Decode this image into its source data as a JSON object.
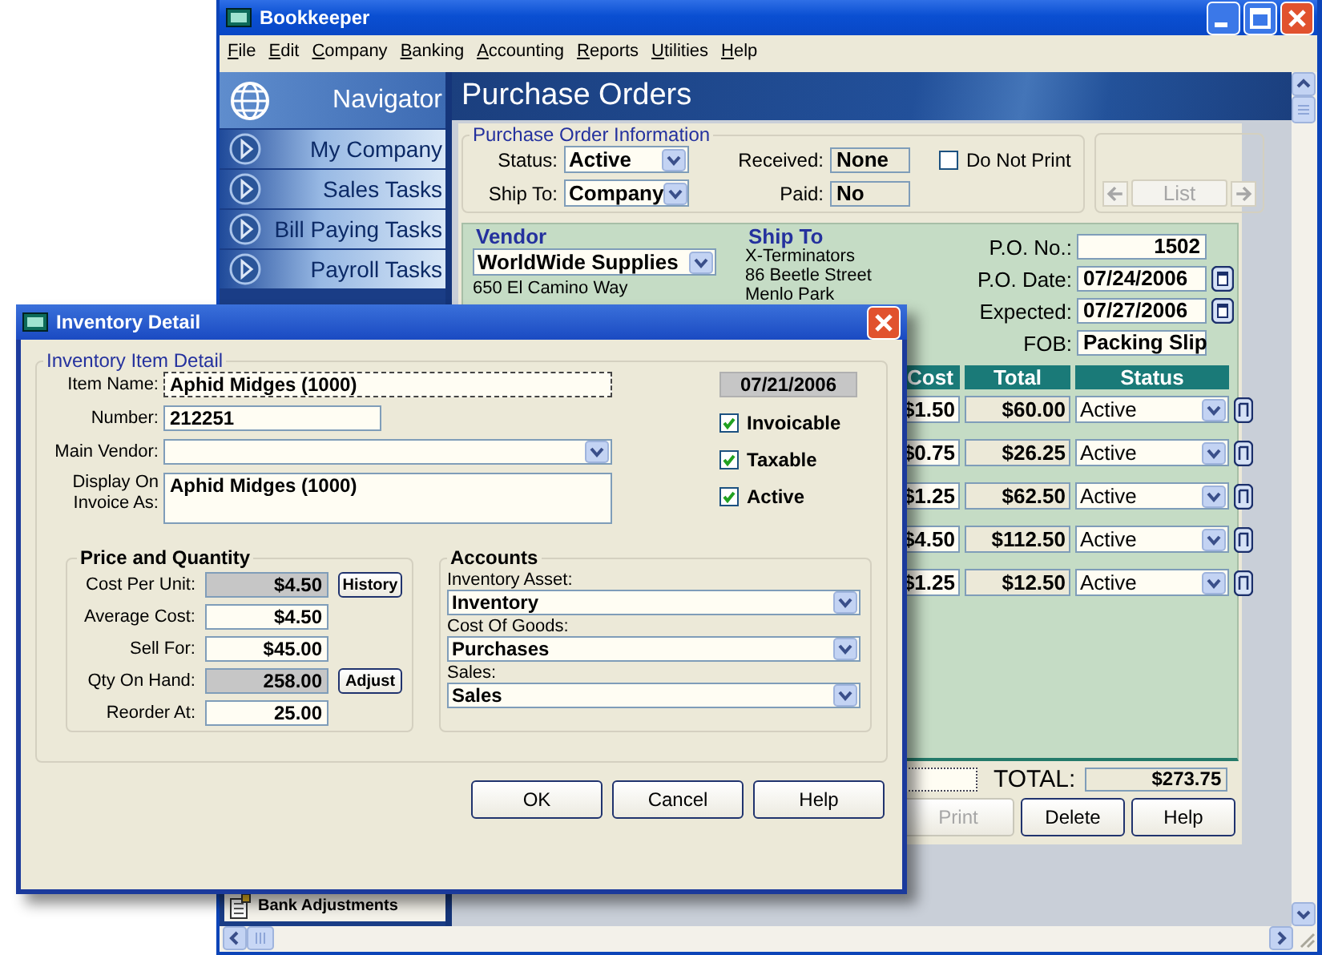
{
  "main_window": {
    "title": "Bookkeeper",
    "menu": [
      "File",
      "Edit",
      "Company",
      "Banking",
      "Accounting",
      "Reports",
      "Utilities",
      "Help"
    ]
  },
  "navigator": {
    "title": "Navigator",
    "items": [
      {
        "label": "My Company"
      },
      {
        "label": "Sales Tasks"
      },
      {
        "label": "Bill Paying Tasks"
      },
      {
        "label": "Payroll Tasks"
      }
    ],
    "bottom_item": "Bank Adjustments"
  },
  "purchase_orders": {
    "title": "Purchase Orders",
    "info": {
      "title": "Purchase Order Information",
      "status_label": "Status:",
      "status": "Active",
      "ship_to_label": "Ship To:",
      "ship_to": "Company",
      "received_label": "Received:",
      "received": "None",
      "paid_label": "Paid:",
      "paid": "No",
      "do_not_print": {
        "label": "Do Not Print",
        "checked": false
      },
      "list_button": {
        "label": "List",
        "disabled": true
      }
    },
    "vendor": {
      "heading": "Vendor",
      "name": "WorldWide Supplies",
      "address": [
        "650 El Camino Way"
      ]
    },
    "ship_to": {
      "heading": "Ship To",
      "lines": [
        "X-Terminators",
        "86 Beetle Street",
        "Menlo Park"
      ]
    },
    "fields": [
      {
        "label": "P.O. No.:",
        "value": "1502",
        "kind": "number"
      },
      {
        "label": "P.O. Date:",
        "value": "07/24/2006",
        "kind": "date"
      },
      {
        "label": "Expected:",
        "value": "07/27/2006",
        "kind": "date"
      },
      {
        "label": "FOB:",
        "value": "Packing Slip",
        "kind": "text"
      }
    ],
    "table": {
      "columns": [
        "Cost",
        "Total",
        "Status"
      ],
      "rows": [
        {
          "cost": "$1.50",
          "total": "$60.00",
          "status": "Active"
        },
        {
          "cost": "$0.75",
          "total": "$26.25",
          "status": "Active"
        },
        {
          "cost": "$1.25",
          "total": "$62.50",
          "status": "Active"
        },
        {
          "cost": "$4.50",
          "total": "$112.50",
          "status": "Active"
        },
        {
          "cost": "$1.25",
          "total": "$12.50",
          "status": "Active"
        }
      ]
    },
    "total_label": "TOTAL:",
    "total": "$273.75",
    "buttons": [
      {
        "label": "Print",
        "disabled": true
      },
      {
        "label": "Delete",
        "disabled": false
      },
      {
        "label": "Help",
        "disabled": false
      }
    ]
  },
  "inventory_dialog": {
    "title": "Inventory Detail",
    "group": "Inventory Item Detail",
    "item_name": {
      "label": "Item Name:",
      "value": "Aphid Midges (1000)"
    },
    "number": {
      "label": "Number:",
      "value": "212251"
    },
    "main_vendor": {
      "label": "Main Vendor:"
    },
    "display_as": {
      "label": "Display On Invoice As:",
      "value": "Aphid Midges (1000)"
    },
    "date": "07/21/2006",
    "flags": [
      {
        "label": "Invoicable",
        "checked": true
      },
      {
        "label": "Taxable",
        "checked": true
      },
      {
        "label": "Active",
        "checked": true
      }
    ],
    "price": {
      "title": "Price and Quantity",
      "rows": [
        {
          "label": "Cost Per Unit:",
          "value": "$4.50",
          "readonly": true,
          "button": "History"
        },
        {
          "label": "Average Cost:",
          "value": "$4.50",
          "readonly": false
        },
        {
          "label": "Sell For:",
          "value": "$45.00",
          "readonly": false
        },
        {
          "label": "Qty On Hand:",
          "value": "258.00",
          "readonly": true,
          "button": "Adjust"
        },
        {
          "label": "Reorder At:",
          "value": "25.00",
          "readonly": false
        }
      ]
    },
    "accounts": {
      "title": "Accounts",
      "rows": [
        {
          "label": "Inventory Asset:",
          "value": "Inventory"
        },
        {
          "label": "Cost Of Goods:",
          "value": "Purchases"
        },
        {
          "label": "Sales:",
          "value": "Sales"
        }
      ]
    },
    "buttons": [
      "OK",
      "Cancel",
      "Help"
    ]
  }
}
